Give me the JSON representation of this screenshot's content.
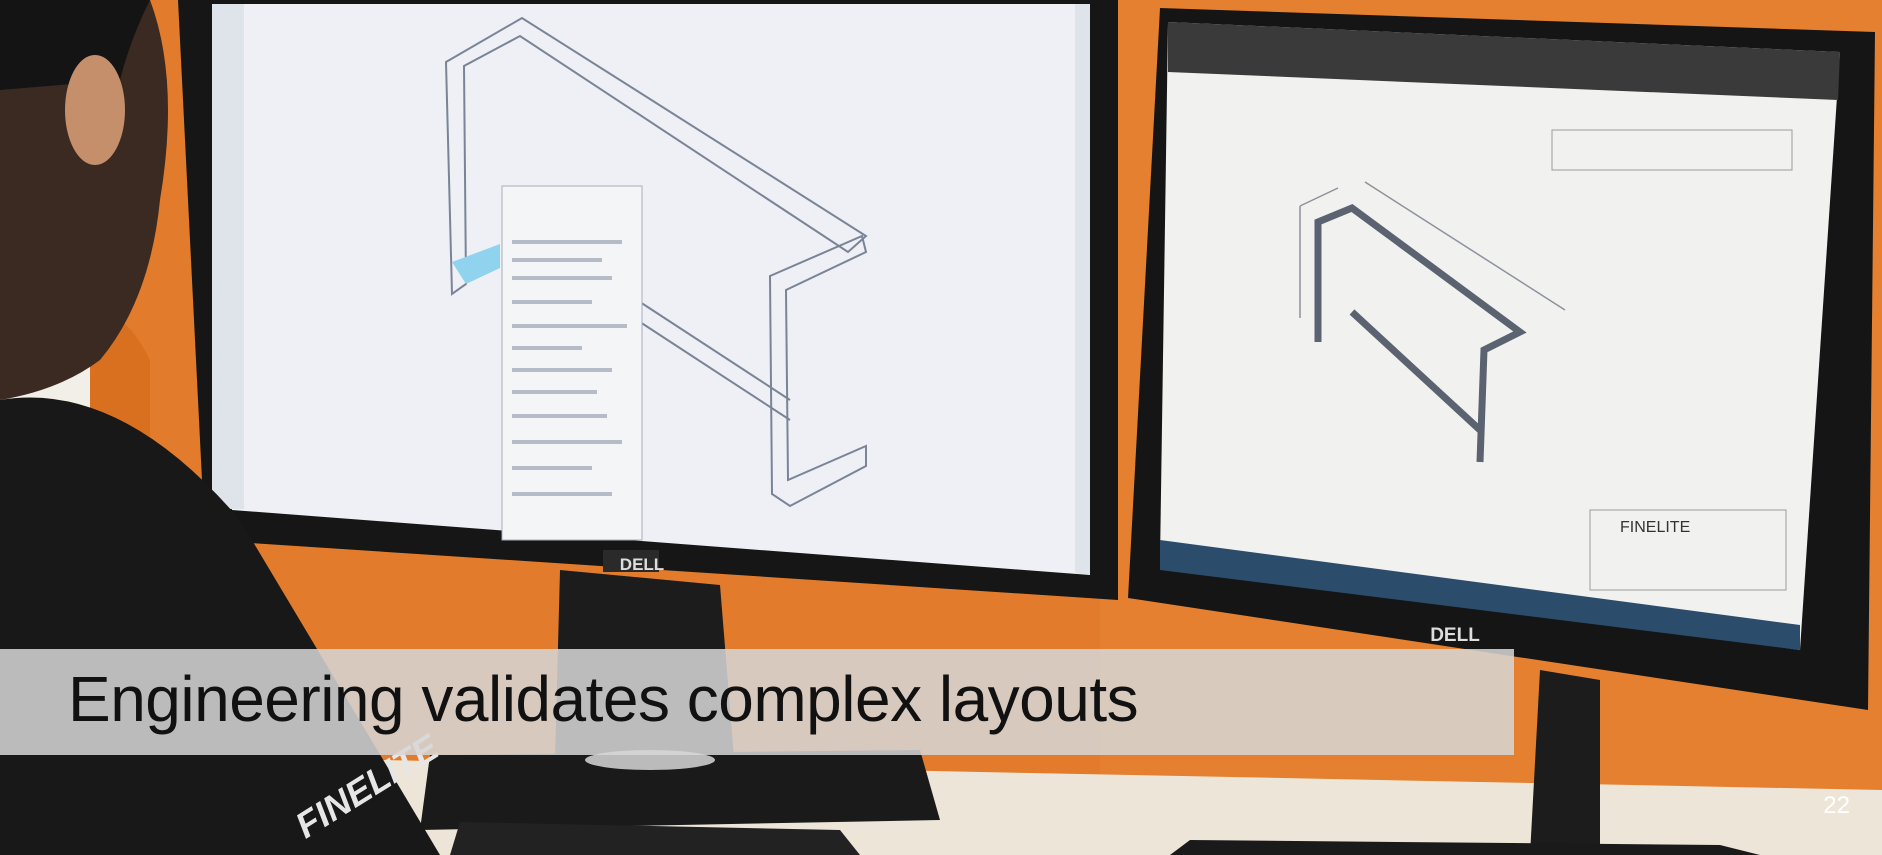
{
  "slide": {
    "caption": "Engineering validates complex layouts",
    "page_number": "22"
  },
  "photo": {
    "monitor_left_brand": "DELL",
    "monitor_right_brand": "DELL",
    "drawing_company": "FINELITE",
    "shirt_logo": "FINELITE"
  },
  "colors": {
    "wall": "#e07a2a",
    "accent_bar": "#1f3a6a",
    "caption_band": "#d6d6d6"
  }
}
